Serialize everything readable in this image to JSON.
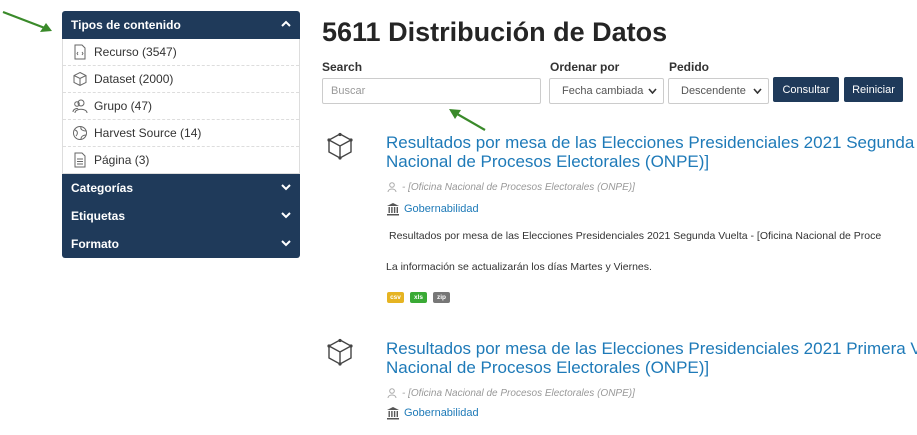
{
  "sidebar": {
    "tipos": {
      "title": "Tipos de contenido",
      "items": [
        {
          "label": "Recurso (3547)",
          "icon": "file-code-icon"
        },
        {
          "label": "Dataset (2000)",
          "icon": "cube-icon"
        },
        {
          "label": "Grupo (47)",
          "icon": "users-icon"
        },
        {
          "label": "Harvest Source (14)",
          "icon": "globe-icon"
        },
        {
          "label": "Página (3)",
          "icon": "page-icon"
        }
      ]
    },
    "categorias": "Categorías",
    "etiquetas": "Etiquetas",
    "formato": "Formato"
  },
  "main": {
    "title": "5611 Distribución de Datos",
    "search_label": "Search",
    "search_placeholder": "Buscar",
    "sort_label": "Ordenar por",
    "sort_value": "Fecha cambiada",
    "order_label": "Pedido",
    "order_value": "Descendente",
    "submit": "Consultar",
    "reset": "Reiniciar"
  },
  "results": [
    {
      "title_line1": "Resultados por mesa de las Elecciones Presidenciales 2021 Segunda",
      "title_line2": "Nacional de Procesos Electorales (ONPE)]",
      "publisher": "- [Oficina Nacional de Procesos Electorales (ONPE)]",
      "category": "Gobernabilidad",
      "desc1": "Resultados por mesa de las Elecciones Presidenciales 2021 Segunda Vuelta - [Oficina Nacional de Proce",
      "desc2": "La información se actualizarán los días Martes y Viernes.",
      "formats": [
        {
          "label": "csv",
          "color": "#e6b422"
        },
        {
          "label": "xls",
          "color": "#3aaa35"
        },
        {
          "label": "zip",
          "color": "#777777"
        }
      ]
    },
    {
      "title_line1": "Resultados por mesa de las Elecciones Presidenciales 2021 Primera V",
      "title_line2": "Nacional de Procesos Electorales (ONPE)]",
      "publisher": "- [Oficina Nacional de Procesos Electorales (ONPE)]",
      "category": "Gobernabilidad"
    }
  ],
  "colors": {
    "navy": "#1f3a5a",
    "link": "#1e7ab8",
    "annotation_arrow": "#3a8a2a"
  }
}
